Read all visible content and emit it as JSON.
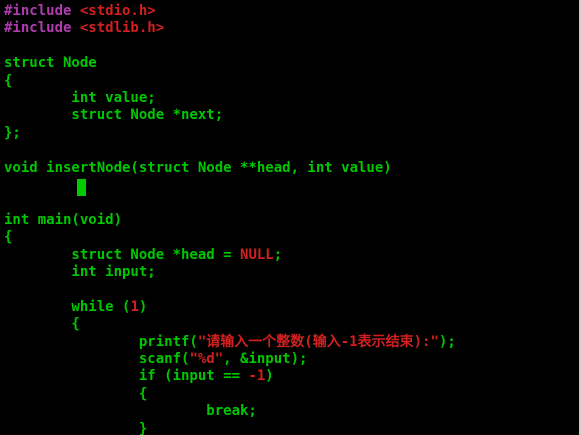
{
  "colors": {
    "background": "#000000",
    "preprocessor": "#b03cb0",
    "include_path": "#d22020",
    "keyword": "#00c800",
    "number": "#d22020",
    "string": "#d22020",
    "default": "#00c800",
    "cursor": "#00cc00"
  },
  "editor": {
    "mode": "vim",
    "cursor_line": 11,
    "lines": [
      {
        "tokens": [
          {
            "text": "#include ",
            "kind": "preprocessor"
          },
          {
            "text": "<stdio.h>",
            "kind": "include_path"
          }
        ]
      },
      {
        "tokens": [
          {
            "text": "#include ",
            "kind": "preprocessor"
          },
          {
            "text": "<stdlib.h>",
            "kind": "include_path"
          }
        ]
      },
      {
        "tokens": []
      },
      {
        "tokens": [
          {
            "text": "struct Node",
            "kind": "keyword"
          }
        ]
      },
      {
        "tokens": [
          {
            "text": "{",
            "kind": "default"
          }
        ]
      },
      {
        "tokens": [
          {
            "text": "        int value;",
            "kind": "default"
          }
        ]
      },
      {
        "tokens": [
          {
            "text": "        struct Node *next;",
            "kind": "default"
          }
        ]
      },
      {
        "tokens": [
          {
            "text": "};",
            "kind": "default"
          }
        ]
      },
      {
        "tokens": []
      },
      {
        "tokens": [
          {
            "text": "void insertNode(struct Node **head, int value)",
            "kind": "default"
          }
        ]
      },
      {
        "tokens": []
      },
      {
        "tokens": []
      },
      {
        "tokens": [
          {
            "text": "int main(void)",
            "kind": "default"
          }
        ]
      },
      {
        "tokens": [
          {
            "text": "{",
            "kind": "default"
          }
        ]
      },
      {
        "tokens": [
          {
            "text": "        struct Node *head = ",
            "kind": "default"
          },
          {
            "text": "NULL",
            "kind": "number"
          },
          {
            "text": ";",
            "kind": "default"
          }
        ]
      },
      {
        "tokens": [
          {
            "text": "        int input;",
            "kind": "default"
          }
        ]
      },
      {
        "tokens": []
      },
      {
        "tokens": [
          {
            "text": "        while (",
            "kind": "default"
          },
          {
            "text": "1",
            "kind": "number"
          },
          {
            "text": ")",
            "kind": "default"
          }
        ]
      },
      {
        "tokens": [
          {
            "text": "        {",
            "kind": "default"
          }
        ]
      },
      {
        "tokens": [
          {
            "text": "                printf(",
            "kind": "default"
          },
          {
            "text": "\"请输入一个整数(输入-1表示结束):\"",
            "kind": "string"
          },
          {
            "text": ");",
            "kind": "default"
          }
        ]
      },
      {
        "tokens": [
          {
            "text": "                scanf(",
            "kind": "default"
          },
          {
            "text": "\"%d\"",
            "kind": "string"
          },
          {
            "text": ", &input);",
            "kind": "default"
          }
        ]
      },
      {
        "tokens": [
          {
            "text": "                if (input == ",
            "kind": "default"
          },
          {
            "text": "-1",
            "kind": "number"
          },
          {
            "text": ")",
            "kind": "default"
          }
        ]
      },
      {
        "tokens": [
          {
            "text": "                {",
            "kind": "default"
          }
        ]
      },
      {
        "tokens": [
          {
            "text": "                        break;",
            "kind": "default"
          }
        ]
      },
      {
        "tokens": [
          {
            "text": "                }",
            "kind": "default"
          }
        ]
      }
    ]
  }
}
